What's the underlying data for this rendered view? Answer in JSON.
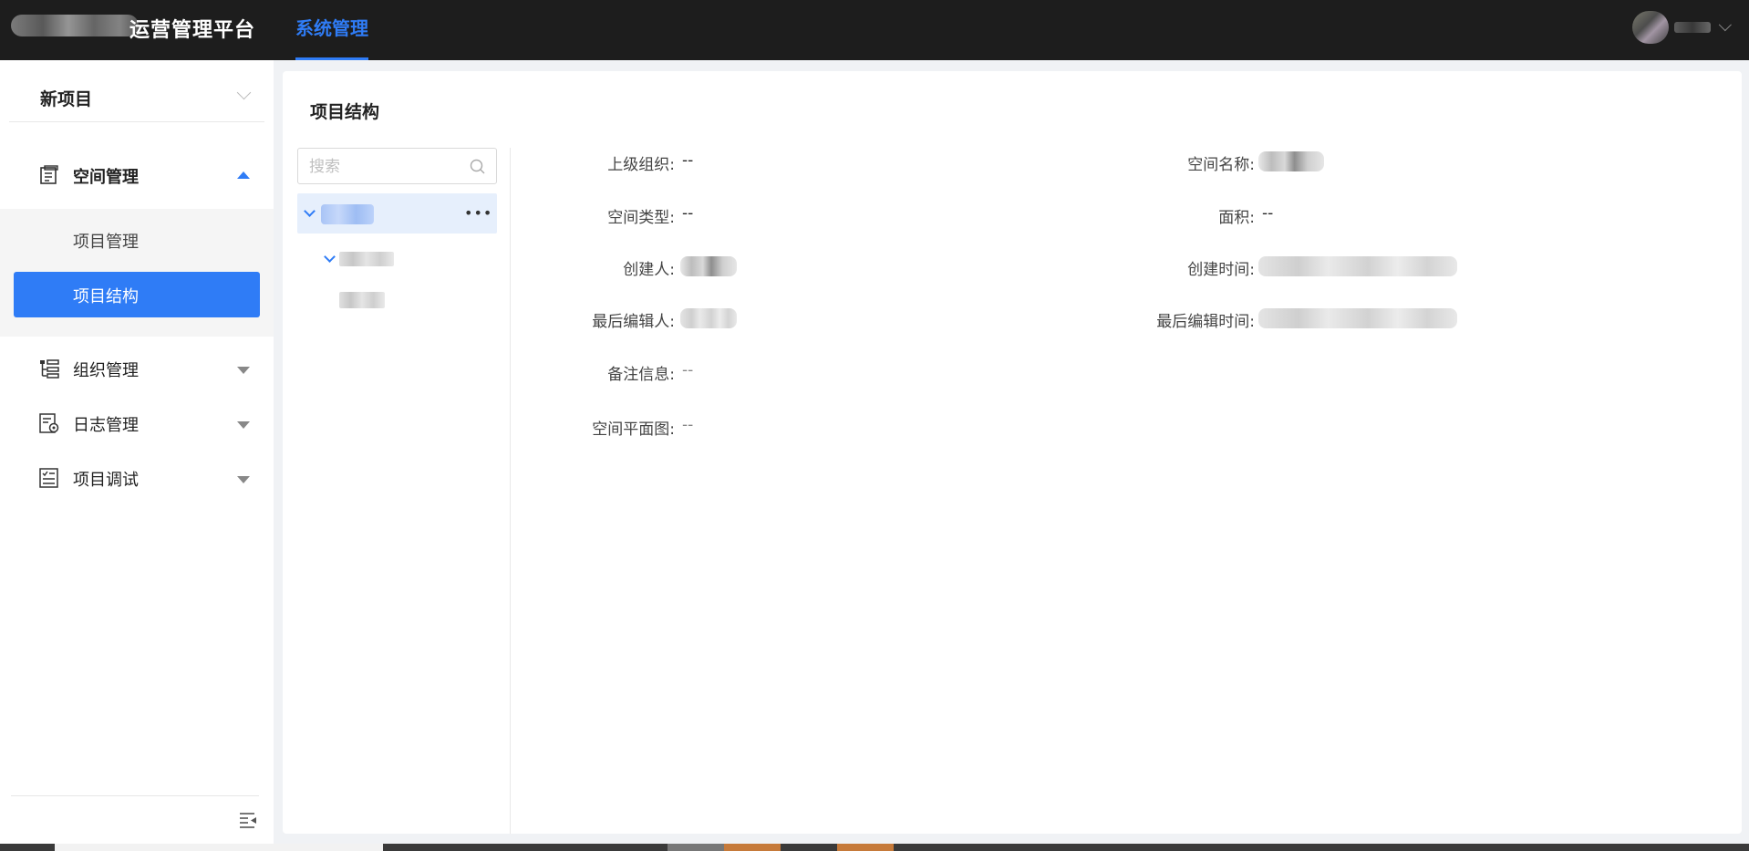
{
  "header": {
    "app_title": "运营管理平台",
    "nav_active": "系统管理",
    "accent_color": "#2f7cf6"
  },
  "sidebar": {
    "project_select": "新项目",
    "groups": [
      {
        "label": "空间管理",
        "icon": "building-icon",
        "expanded": true,
        "children": [
          {
            "label": "项目管理"
          },
          {
            "label": "项目结构",
            "active": true
          }
        ]
      },
      {
        "label": "组织管理",
        "icon": "org-tree-icon",
        "expanded": false
      },
      {
        "label": "日志管理",
        "icon": "log-settings-icon",
        "expanded": false
      },
      {
        "label": "项目调试",
        "icon": "debug-list-icon",
        "expanded": false
      }
    ]
  },
  "main": {
    "title": "项目结构",
    "tree": {
      "search_placeholder": "搜索"
    },
    "details": {
      "parent_org_label": "上级组织:",
      "parent_org_value": "--",
      "space_name_label": "空间名称:",
      "space_type_label": "空间类型:",
      "space_type_value": "--",
      "area_label": "面积:",
      "area_value": "--",
      "creator_label": "创建人:",
      "created_time_label": "创建时间:",
      "last_editor_label": "最后编辑人:",
      "last_edit_time_label": "最后编辑时间:",
      "remark_label": "备注信息:",
      "remark_value": "--",
      "floor_plan_label": "空间平面图:",
      "floor_plan_value": "--"
    }
  }
}
